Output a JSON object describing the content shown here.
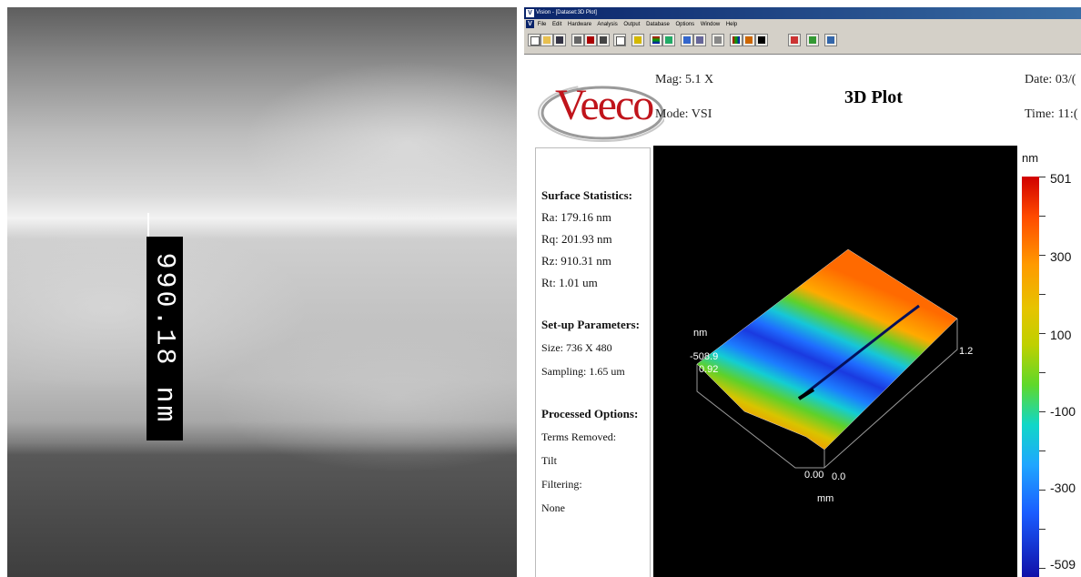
{
  "sem": {
    "measurement_label": "990.18 nm"
  },
  "window": {
    "title": "Vision - [Dataset:3D Plot]",
    "app_icon_glyph": "V",
    "menu": [
      "File",
      "Edit",
      "Hardware",
      "Analysis",
      "Output",
      "Database",
      "Options",
      "Window",
      "Help"
    ],
    "toolbar_icons": [
      "new-icon",
      "open-icon",
      "save-icon",
      "print-icon",
      "measure-icon",
      "data-icon",
      "copy-icon",
      "plot2d-icon",
      "plot3d-icon",
      "contour-icon",
      "histogram-icon",
      "stats-icon",
      "profile-icon",
      "filter-icon",
      "mask-icon",
      "stop-icon",
      "settings-icon",
      "help-icon"
    ]
  },
  "report": {
    "logo_text": "Veeco",
    "mag": "Mag: 5.1 X",
    "mode": "Mode: VSI",
    "title": "3D Plot",
    "date": "Date: 03/(",
    "time": "Time: 11:("
  },
  "stats": {
    "surface_heading": "Surface Statistics:",
    "ra": "Ra: 179.16 nm",
    "rq": "Rq: 201.93 nm",
    "rz": "Rz: 910.31 nm",
    "rt": "Rt: 1.01 um",
    "setup_heading": "Set-up Parameters:",
    "size": "Size: 736 X 480",
    "sampling": "Sampling: 1.65 um",
    "processed_heading": "Processed Options:",
    "terms_removed": "Terms Removed:",
    "tilt": "Tilt",
    "filtering": "Filtering:",
    "none": "None"
  },
  "plot_labels": {
    "z_unit": "nm",
    "z_min": "-508.9",
    "y_max": "0.92",
    "x_max": "1.2",
    "origin_y": "0.00",
    "origin_x": "0.0",
    "xy_unit": "mm"
  },
  "colorbar": {
    "unit": "nm",
    "labels": [
      "501",
      "300",
      "100",
      "-100",
      "-300",
      "-509"
    ],
    "colors": {
      "top": "#d00000",
      "middle": "#5fd82a",
      "bottom": "#1010a8"
    }
  }
}
